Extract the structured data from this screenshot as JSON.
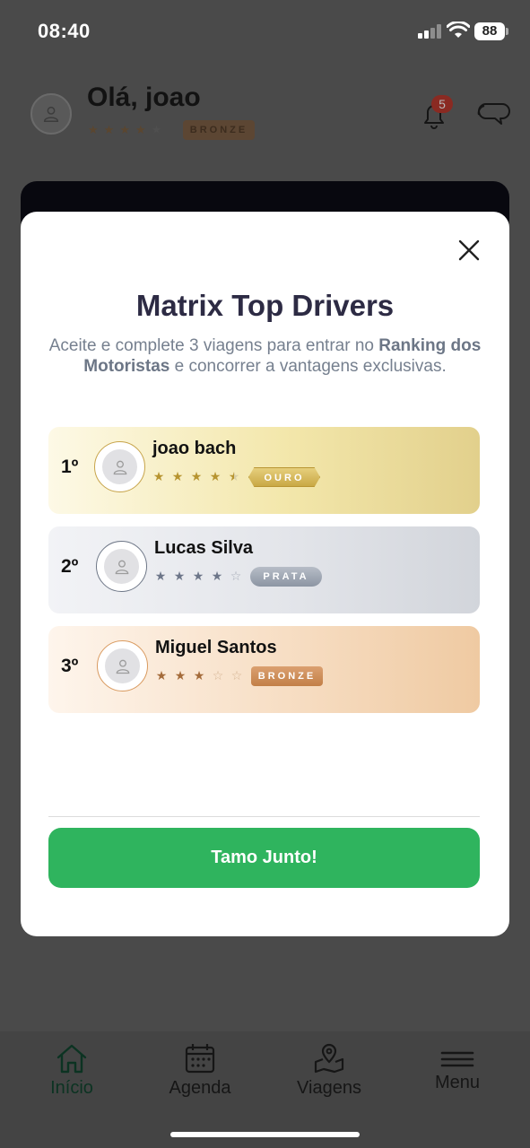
{
  "status_bar": {
    "time": "08:40",
    "battery": "88"
  },
  "header": {
    "greeting": "Olá, joao",
    "stars": [
      "★",
      "★",
      "★",
      "★",
      "★"
    ],
    "level_badge": "BRONZE",
    "notification_count": "5"
  },
  "modal": {
    "title": "Matrix Top Drivers",
    "subtitle_pre": "Aceite e complete 3 viagens para entrar no ",
    "subtitle_bold": "Ranking dos Motoristas",
    "subtitle_post": " e concorrer a vantagens exclusivas.",
    "ranking": [
      {
        "position": "1º",
        "name": "joao bach",
        "badge": "OURO",
        "rating": 4.5
      },
      {
        "position": "2º",
        "name": "Lucas Silva",
        "badge": "PRATA",
        "rating": 4
      },
      {
        "position": "3º",
        "name": "Miguel Santos",
        "badge": "BRONZE",
        "rating": 3
      }
    ],
    "cta_label": "Tamo Junto!"
  },
  "bottom_nav": {
    "items": [
      {
        "label": "Início",
        "icon": "home-icon"
      },
      {
        "label": "Agenda",
        "icon": "calendar-icon"
      },
      {
        "label": "Viagens",
        "icon": "map-pin-icon"
      },
      {
        "label": "Menu",
        "icon": "menu-icon"
      }
    ]
  },
  "colors": {
    "overlay": "#4a4a4a",
    "cta": "#2fb45e",
    "gold": "#c9a845",
    "silver": "#8c95a3",
    "bronze": "#c27f47"
  }
}
